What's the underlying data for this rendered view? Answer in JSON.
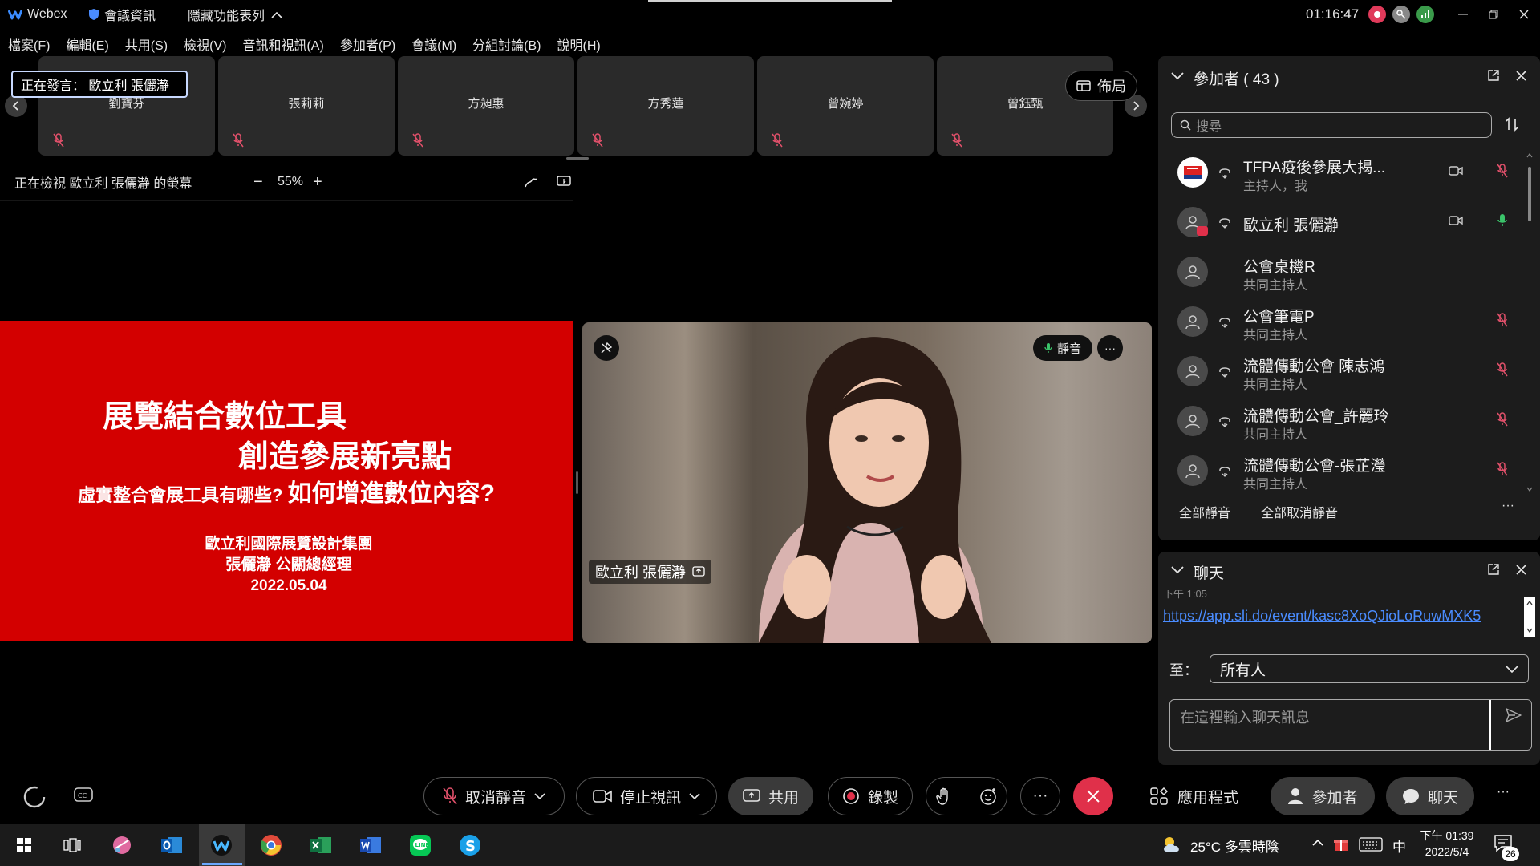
{
  "titlebar": {
    "app": "Webex",
    "meeting_info": "會議資訊",
    "hide_menu": "隱藏功能表列",
    "time": "01:16:47"
  },
  "menubar": [
    "檔案(F)",
    "編輯(E)",
    "共用(S)",
    "檢視(V)",
    "音訊和視訊(A)",
    "參加者(P)",
    "會議(M)",
    "分組討論(B)",
    "說明(H)"
  ],
  "speaking": "正在發言： 歐立利 張儷瀞",
  "tiles": [
    "劉寶芬",
    "張莉莉",
    "方昶惠",
    "方秀蓮",
    "曾婉婷",
    "曾鈺甄"
  ],
  "layout_label": "佈局",
  "viewing": {
    "label": "正在檢視 歐立利 張儷瀞 的螢幕",
    "zoom": "55%",
    "minus": "−",
    "plus": "+"
  },
  "slide": {
    "line1": "展覽結合數位工具",
    "line2": "創造參展新亮點",
    "line3a": "虛實整合會展工具有哪些?",
    "line3b": "如何增進數位內容?",
    "org": "歐立利國際展覽設計集團",
    "person": "張儷瀞 公關總經理",
    "date": "2022.05.04"
  },
  "video": {
    "name": "歐立利 張儷瀞",
    "mute_label": "靜音",
    "more": "···"
  },
  "participants": {
    "title": "參加者 ( 43 )",
    "search_placeholder": "搜尋",
    "list": [
      {
        "name": "TFPA疫後參展大揭...",
        "role": "主持人，我"
      },
      {
        "name": "歐立利 張儷瀞",
        "role": ""
      },
      {
        "name": "公會桌機R",
        "role": "共同主持人"
      },
      {
        "name": "公會筆電P",
        "role": "共同主持人"
      },
      {
        "name": "流體傳動公會 陳志鴻",
        "role": "共同主持人"
      },
      {
        "name": "流體傳動公會_許麗玲",
        "role": "共同主持人"
      },
      {
        "name": "流體傳動公會-張芷瀅",
        "role": "共同主持人"
      }
    ],
    "mute_all": "全部靜音",
    "unmute_all": "全部取消靜音",
    "more": "···"
  },
  "chat": {
    "title": "聊天",
    "partial_line": "下午 1:05",
    "link": "https://app.sli.do/event/kasc8XoQJioLoRuwMXK5",
    "to_label": "至：",
    "to_value": "所有人",
    "input_placeholder": "在這裡輸入聊天訊息"
  },
  "controls": {
    "unmute": "取消靜音",
    "stop_video": "停止視訊",
    "share": "共用",
    "record": "錄製",
    "more": "···",
    "apps": "應用程式",
    "participants": "參加者",
    "chat": "聊天"
  },
  "taskbar": {
    "weather": "25°C 多雲時陰",
    "ime": "中",
    "clock_time": "下午 01:39",
    "clock_date": "2022/5/4",
    "notif_count": "26"
  }
}
